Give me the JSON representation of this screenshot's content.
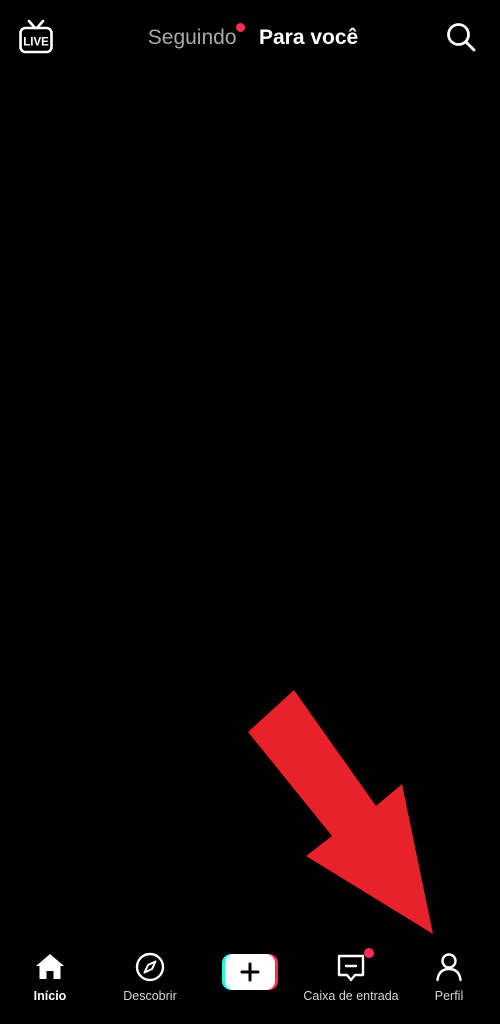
{
  "top_bar": {
    "live_label": "LIVE",
    "tabs": [
      {
        "label": "Seguindo",
        "has_notification_dot": true
      },
      {
        "label": "Para você",
        "active": true
      }
    ],
    "search_icon": "search-icon"
  },
  "bottom_nav": {
    "items": [
      {
        "label": "Início",
        "icon": "home-icon",
        "active": true
      },
      {
        "label": "Descobrir",
        "icon": "compass-icon"
      },
      {
        "label": "",
        "icon": "plus-icon"
      },
      {
        "label": "Caixa de entrada",
        "icon": "inbox-icon",
        "has_notification_dot": true
      },
      {
        "label": "Perfil",
        "icon": "person-icon"
      }
    ]
  },
  "colors": {
    "background": "#000000",
    "notification_dot": "#fe2c55",
    "accent_cyan": "#25f4ee",
    "annotation_arrow": "#e8222a"
  }
}
